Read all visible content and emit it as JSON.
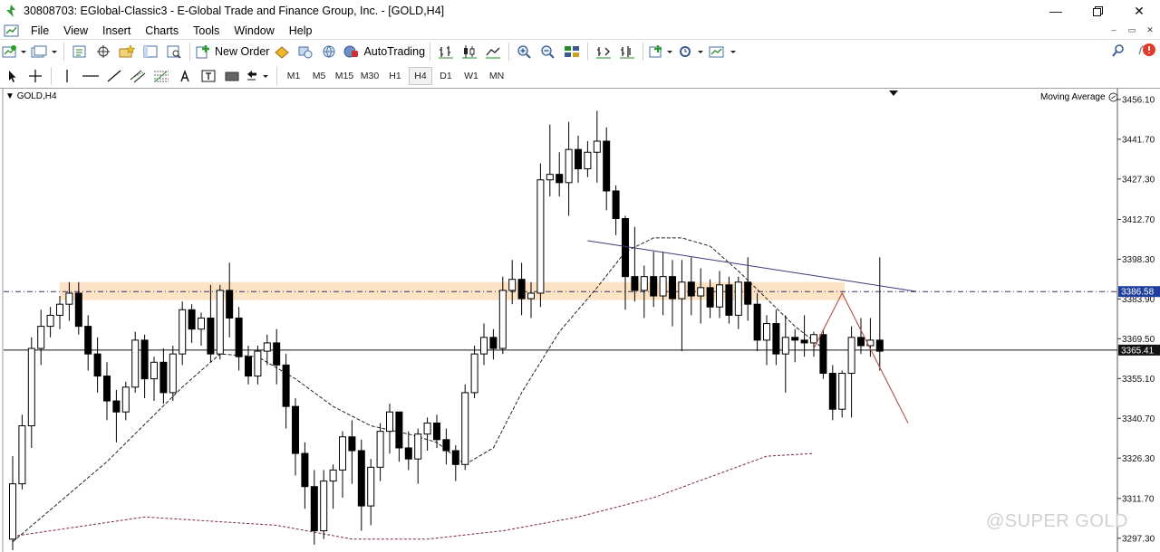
{
  "window": {
    "title": "30808703: EGlobal-Classic3 - E-Global Trade and Finance Group, Inc. - [GOLD,H4]"
  },
  "menu": [
    "File",
    "View",
    "Insert",
    "Charts",
    "Tools",
    "Window",
    "Help"
  ],
  "toolbar": {
    "new_order_label": "New Order",
    "autotrading_label": "AutoTrading",
    "timeframes": [
      "M1",
      "M5",
      "M15",
      "M30",
      "H1",
      "H4",
      "D1",
      "W1",
      "MN"
    ],
    "active_timeframe": "H4"
  },
  "chart": {
    "symbol_label": "GOLD,H4",
    "indicator_label": "Moving Average",
    "watermark": "@SUPER GOLD",
    "colors": {
      "zone": "#fde3c6",
      "candle": "#000000",
      "trendline": "#3a3a7a",
      "projection": "#b05050",
      "ma_slow": "#7a2a3a",
      "price_tag": "#1f3f9f"
    }
  },
  "chart_data": {
    "type": "candlestick",
    "symbol": "GOLD",
    "timeframe": "H4",
    "ylim": [
      3292,
      3460
    ],
    "price_ticks": [
      3456.1,
      3441.7,
      3427.3,
      3412.7,
      3398.3,
      3383.9,
      3369.5,
      3355.1,
      3340.7,
      3326.3,
      3311.7,
      3297.3
    ],
    "price_tick_labels": [
      "3456.10",
      "3441.70",
      "3427.30",
      "3412.70",
      "3398.30",
      "3383.90",
      "3369.50",
      "3355.10",
      "3340.70",
      "3326.30",
      "3311.70",
      "3297.30"
    ],
    "markers": [
      {
        "label": "3386.58",
        "value": 3386.58,
        "style": "dash-dot"
      },
      {
        "label": "3365.41",
        "value": 3365.41,
        "style": "solid"
      }
    ],
    "zone": {
      "from": 3383.5,
      "to": 3390.0
    },
    "candles": [
      [
        3297,
        3327,
        3293,
        3317
      ],
      [
        3317,
        3342,
        3315,
        3338
      ],
      [
        3338,
        3370,
        3330,
        3366
      ],
      [
        3366,
        3380,
        3360,
        3374
      ],
      [
        3374,
        3381,
        3370,
        3378
      ],
      [
        3378,
        3385,
        3373,
        3382
      ],
      [
        3382,
        3390,
        3376,
        3386
      ],
      [
        3386,
        3390,
        3371,
        3374
      ],
      [
        3374,
        3378,
        3358,
        3364
      ],
      [
        3364,
        3370,
        3350,
        3356
      ],
      [
        3356,
        3361,
        3340,
        3347
      ],
      [
        3347,
        3351,
        3332,
        3343
      ],
      [
        3343,
        3354,
        3340,
        3352
      ],
      [
        3352,
        3372,
        3350,
        3369
      ],
      [
        3369,
        3371,
        3348,
        3355
      ],
      [
        3355,
        3363,
        3347,
        3361
      ],
      [
        3361,
        3366,
        3346,
        3350
      ],
      [
        3350,
        3367,
        3347,
        3364
      ],
      [
        3364,
        3383,
        3360,
        3380
      ],
      [
        3380,
        3382,
        3368,
        3373
      ],
      [
        3373,
        3379,
        3367,
        3377
      ],
      [
        3377,
        3389,
        3361,
        3364
      ],
      [
        3364,
        3389,
        3362,
        3387
      ],
      [
        3387,
        3397,
        3370,
        3377
      ],
      [
        3377,
        3381,
        3358,
        3363
      ],
      [
        3363,
        3367,
        3353,
        3356
      ],
      [
        3356,
        3367,
        3353,
        3365
      ],
      [
        3365,
        3371,
        3360,
        3368
      ],
      [
        3368,
        3373,
        3353,
        3360
      ],
      [
        3360,
        3364,
        3337,
        3345
      ],
      [
        3345,
        3348,
        3320,
        3328
      ],
      [
        3328,
        3332,
        3308,
        3316
      ],
      [
        3316,
        3322,
        3295,
        3300
      ],
      [
        3300,
        3322,
        3297,
        3318
      ],
      [
        3318,
        3324,
        3308,
        3322
      ],
      [
        3322,
        3336,
        3312,
        3334
      ],
      [
        3334,
        3340,
        3317,
        3329
      ],
      [
        3329,
        3333,
        3300,
        3309
      ],
      [
        3309,
        3326,
        3302,
        3323
      ],
      [
        3323,
        3339,
        3318,
        3336
      ],
      [
        3336,
        3346,
        3328,
        3343
      ],
      [
        3343,
        3343,
        3325,
        3330
      ],
      [
        3330,
        3336,
        3322,
        3326
      ],
      [
        3326,
        3337,
        3317,
        3335
      ],
      [
        3335,
        3341,
        3329,
        3339
      ],
      [
        3339,
        3342,
        3330,
        3333
      ],
      [
        3333,
        3337,
        3324,
        3329
      ],
      [
        3329,
        3331,
        3318,
        3324
      ],
      [
        3324,
        3353,
        3322,
        3350
      ],
      [
        3350,
        3367,
        3348,
        3364
      ],
      [
        3364,
        3375,
        3360,
        3370
      ],
      [
        3370,
        3373,
        3362,
        3366
      ],
      [
        3366,
        3392,
        3364,
        3387
      ],
      [
        3387,
        3398,
        3382,
        3391
      ],
      [
        3391,
        3397,
        3378,
        3384
      ],
      [
        3384,
        3390,
        3377,
        3386
      ],
      [
        3386,
        3433,
        3381,
        3427
      ],
      [
        3427,
        3447,
        3421,
        3429
      ],
      [
        3429,
        3437,
        3421,
        3426
      ],
      [
        3426,
        3448,
        3414,
        3438
      ],
      [
        3438,
        3443,
        3426,
        3431
      ],
      [
        3431,
        3441,
        3428,
        3437
      ],
      [
        3437,
        3452,
        3426,
        3441
      ],
      [
        3441,
        3446,
        3416,
        3423
      ],
      [
        3423,
        3425,
        3407,
        3413
      ],
      [
        3413,
        3414,
        3380,
        3392
      ],
      [
        3392,
        3410,
        3383,
        3387
      ],
      [
        3387,
        3396,
        3377,
        3392
      ],
      [
        3392,
        3401,
        3381,
        3385
      ],
      [
        3385,
        3401,
        3378,
        3392
      ],
      [
        3392,
        3398,
        3374,
        3384
      ],
      [
        3384,
        3398,
        3365,
        3390
      ],
      [
        3390,
        3399,
        3378,
        3385
      ],
      [
        3385,
        3395,
        3375,
        3388
      ],
      [
        3388,
        3391,
        3377,
        3381
      ],
      [
        3381,
        3394,
        3377,
        3389
      ],
      [
        3389,
        3392,
        3375,
        3378
      ],
      [
        3378,
        3392,
        3373,
        3390
      ],
      [
        3390,
        3399,
        3376,
        3382
      ],
      [
        3382,
        3386,
        3365,
        3369
      ],
      [
        3369,
        3378,
        3360,
        3375
      ],
      [
        3375,
        3380,
        3360,
        3364
      ],
      [
        3364,
        3378,
        3350,
        3370
      ],
      [
        3370,
        3373,
        3361,
        3369
      ],
      [
        3369,
        3378,
        3363,
        3368
      ],
      [
        3368,
        3372,
        3363,
        3371
      ],
      [
        3371,
        3373,
        3355,
        3357
      ],
      [
        3357,
        3360,
        3340,
        3344
      ],
      [
        3344,
        3358,
        3341,
        3357
      ],
      [
        3357,
        3374,
        3341,
        3370
      ],
      [
        3370,
        3377,
        3364,
        3367
      ],
      [
        3367,
        3377,
        3363,
        3369
      ],
      [
        3369,
        3399,
        3358,
        3365
      ]
    ],
    "trendline": [
      [
        61,
        3405
      ],
      [
        92,
        3385
      ]
    ],
    "projection": [
      [
        85,
        3366
      ],
      [
        88,
        3386
      ],
      [
        95,
        3339
      ]
    ],
    "ma_fast": [
      [
        0,
        3296
      ],
      [
        10,
        3325
      ],
      [
        18,
        3352
      ],
      [
        22,
        3364
      ],
      [
        26,
        3363
      ],
      [
        30,
        3355
      ],
      [
        34,
        3345
      ],
      [
        38,
        3338
      ],
      [
        42,
        3335
      ],
      [
        45,
        3332
      ],
      [
        48,
        3324
      ],
      [
        51,
        3330
      ],
      [
        54,
        3350
      ],
      [
        58,
        3372
      ],
      [
        62,
        3388
      ],
      [
        65,
        3401
      ],
      [
        68,
        3406
      ],
      [
        71,
        3406
      ],
      [
        74,
        3403
      ],
      [
        77,
        3394
      ],
      [
        80,
        3384
      ],
      [
        83,
        3374
      ],
      [
        86,
        3366
      ]
    ],
    "ma_slow": [
      [
        0,
        3298
      ],
      [
        14,
        3305
      ],
      [
        28,
        3302
      ],
      [
        36,
        3297
      ],
      [
        44,
        3297
      ],
      [
        52,
        3300
      ],
      [
        60,
        3305
      ],
      [
        68,
        3312
      ],
      [
        76,
        3322
      ],
      [
        80,
        3327
      ],
      [
        85,
        3328
      ]
    ]
  }
}
